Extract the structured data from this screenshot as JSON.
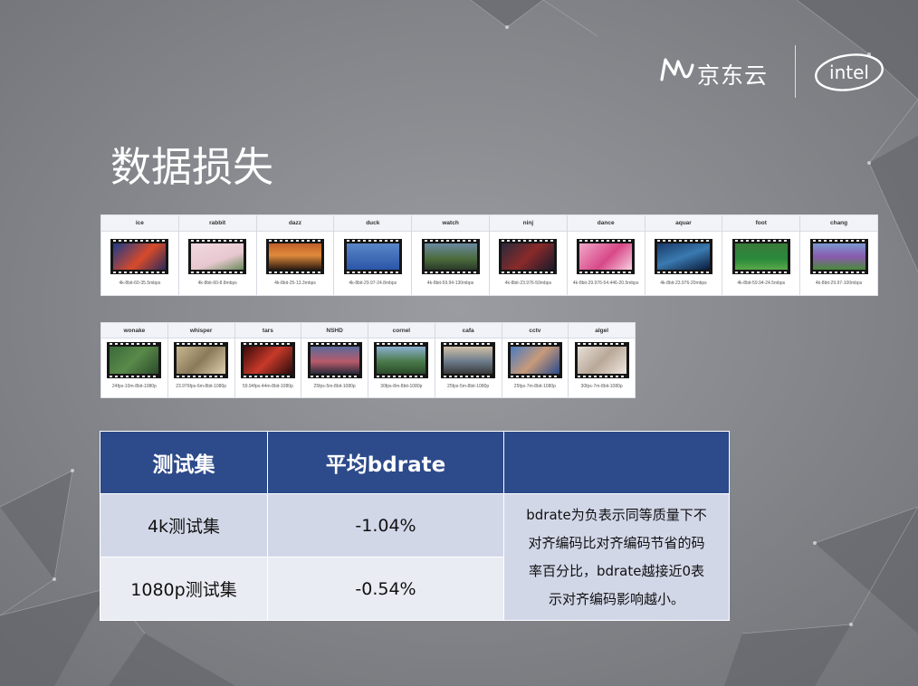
{
  "header": {
    "jd_brand": "京东云",
    "intel_brand": "intel"
  },
  "page_title": "数据损失",
  "strip_4k": [
    {
      "name": "ice",
      "spec": "4k-8bit-60-35.5mbps"
    },
    {
      "name": "rabbit",
      "spec": "4k-8bit-60-8.8mbps"
    },
    {
      "name": "dazz",
      "spec": "4k-8bit-25-13.3mbps"
    },
    {
      "name": "duck",
      "spec": "4k-8bit-29.97-24.8mbps"
    },
    {
      "name": "watch",
      "spec": "4k-8bit-59.94-130mbps"
    },
    {
      "name": "ninj",
      "spec": "4k-8bit-23.976-50mbps"
    },
    {
      "name": "dance",
      "spec": "4k-8bit-29.976-54.446-20.5mbps"
    },
    {
      "name": "aquar",
      "spec": "4k-8bit-23.976-20mbps"
    },
    {
      "name": "foot",
      "spec": "4k-8bit-59.94-24.5mbps"
    },
    {
      "name": "chang",
      "spec": "4k-8bit-29.97-100mbps"
    }
  ],
  "strip_1080p": [
    {
      "name": "wonake",
      "spec": "24fps-10m-8bit-1080p"
    },
    {
      "name": "whisper",
      "spec": "23.976fps-6m-8bit-1080p"
    },
    {
      "name": "tars",
      "spec": "59.94fps-44m-8bit-1080p"
    },
    {
      "name": "NSHD",
      "spec": "25fps-5m-8bit-1080p"
    },
    {
      "name": "cornel",
      "spec": "30fps-8m-8bit-1080p"
    },
    {
      "name": "cafa",
      "spec": "25fps-5m-8bit-1080p"
    },
    {
      "name": "cctv",
      "spec": "25fps-7m-8bit-1080p"
    },
    {
      "name": "algel",
      "spec": "30fps-7m-8bit-1080p"
    }
  ],
  "table": {
    "headers": [
      "测试集",
      "平均bdrate",
      ""
    ],
    "rows": [
      {
        "set": "4k测试集",
        "bdrate": "-1.04%"
      },
      {
        "set": "1080p测试集",
        "bdrate": "-0.54%"
      }
    ],
    "note_lines": [
      "bdrate为负表示同等质量下不",
      "对齐编码比对齐编码节省的码",
      "率百分比，bdrate越接近0表",
      "示对齐编码影响越小。"
    ]
  }
}
